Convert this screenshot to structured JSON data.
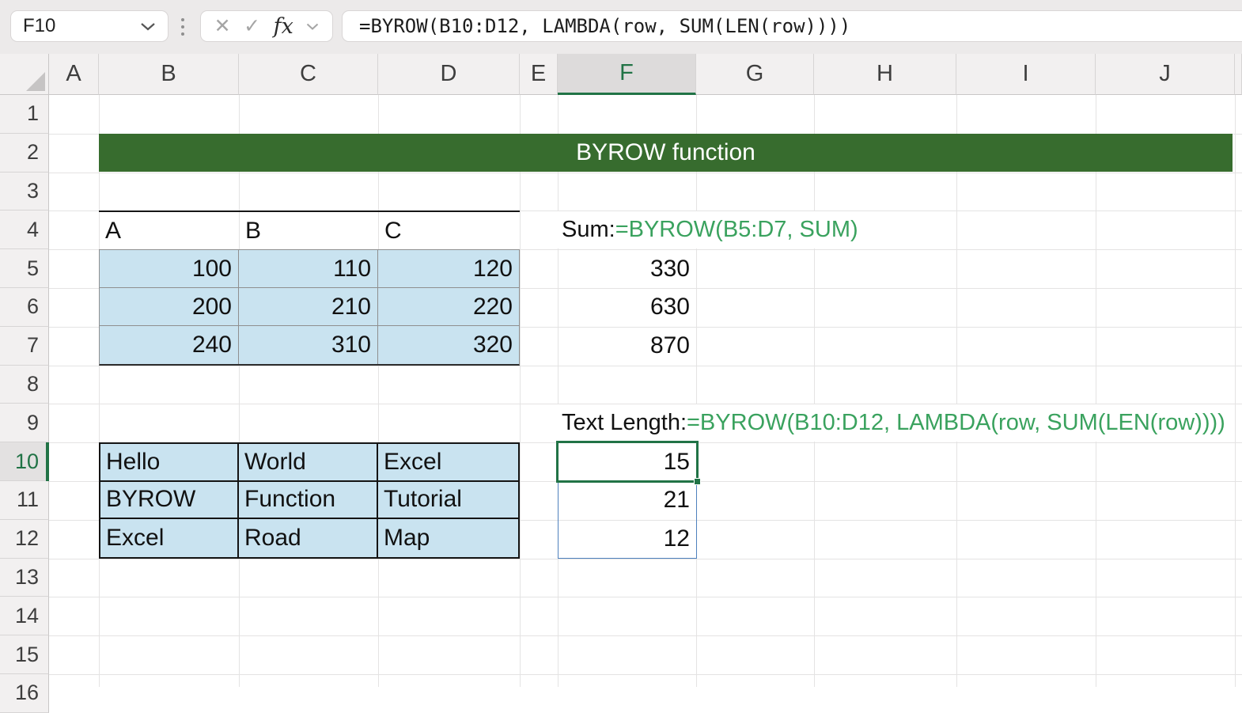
{
  "toolbar": {
    "name_box": "F10",
    "cancel_icon": "✕",
    "confirm_icon": "✓",
    "fx_label": "fx",
    "formula": "=BYROW(B10:D12, LAMBDA(row, SUM(LEN(row))))"
  },
  "banner": {
    "text": "BYROW function"
  },
  "grid": {
    "column_labels": [
      "A",
      "B",
      "C",
      "D",
      "E",
      "F",
      "G",
      "H",
      "I",
      "J"
    ],
    "row_labels": [
      "1",
      "2",
      "3",
      "4",
      "5",
      "6",
      "7",
      "8",
      "9",
      "10",
      "11",
      "12",
      "13",
      "14",
      "15",
      "16"
    ],
    "selected_column": "F",
    "selected_row": "10",
    "active_cell": "F10"
  },
  "sum_section": {
    "column_headers": [
      "A",
      "B",
      "C"
    ],
    "data": [
      [
        "100",
        "110",
        "120"
      ],
      [
        "200",
        "210",
        "220"
      ],
      [
        "240",
        "310",
        "320"
      ]
    ],
    "label": "Sum:",
    "formula": "=BYROW(B5:D7, SUM)",
    "results": [
      "330",
      "630",
      "870"
    ]
  },
  "len_section": {
    "data": [
      [
        "Hello",
        "World",
        "Excel"
      ],
      [
        "BYROW",
        "Function",
        "Tutorial"
      ],
      [
        "Excel",
        "Road",
        "Map"
      ]
    ],
    "label": "Text Length: ",
    "formula": "=BYROW(B10:D12, LAMBDA(row, SUM(LEN(row))))",
    "results": [
      "15",
      "21",
      "12"
    ]
  },
  "colors": {
    "banner_green": "#376c2e",
    "formula_green": "#3aa25e",
    "selection_green": "#217346",
    "spill_border_blue": "#4f81bd",
    "cell_fill_blue": "#c9e3f0"
  }
}
